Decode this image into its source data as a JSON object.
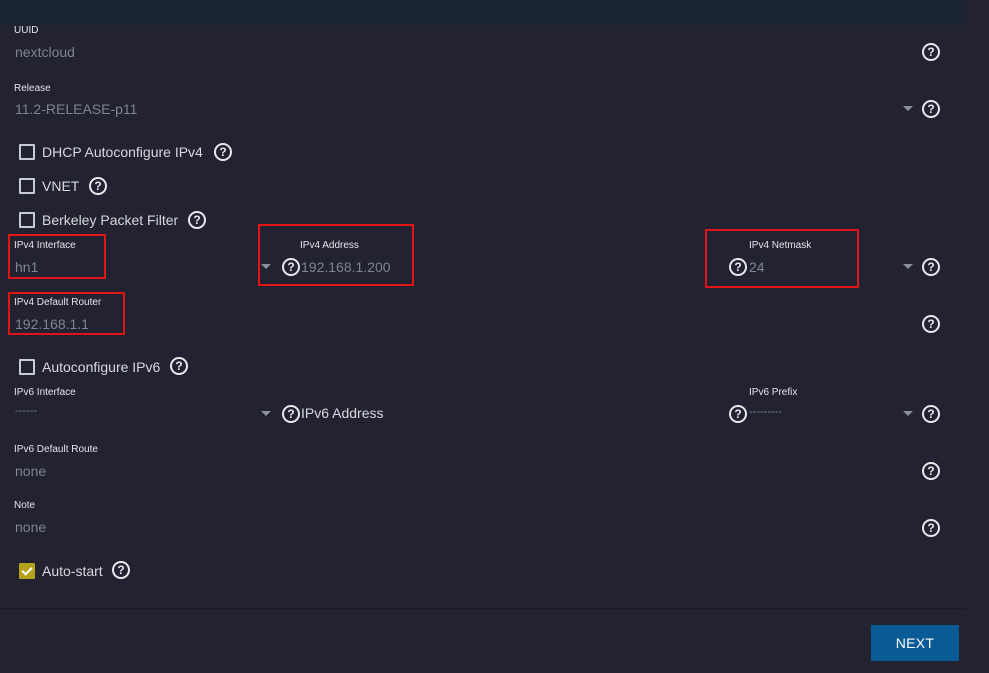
{
  "fields": {
    "uuid": {
      "label": "UUID",
      "value": "nextcloud"
    },
    "release": {
      "label": "Release",
      "value": "11.2-RELEASE-p11"
    },
    "ipv4_interface": {
      "label": "IPv4 Interface",
      "value": "hn1"
    },
    "ipv4_address": {
      "label": "IPv4 Address",
      "value": "192.168.1.200"
    },
    "ipv4_netmask": {
      "label": "IPv4 Netmask",
      "value": "24"
    },
    "ipv4_default_router": {
      "label": "IPv4 Default Router",
      "value": "192.168.1.1"
    },
    "ipv6_interface": {
      "label": "IPv6 Interface",
      "value": "------"
    },
    "ipv6_address": {
      "label": "IPv6 Address"
    },
    "ipv6_prefix": {
      "label": "IPv6 Prefix",
      "value": "---------"
    },
    "ipv6_default_route": {
      "label": "IPv6 Default Route",
      "value": "none"
    },
    "note": {
      "label": "Note",
      "value": "none"
    }
  },
  "checkboxes": {
    "dhcp": {
      "label": "DHCP Autoconfigure IPv4",
      "checked": false
    },
    "vnet": {
      "label": "VNET",
      "checked": false
    },
    "bpf": {
      "label": "Berkeley Packet Filter",
      "checked": false
    },
    "autoconf_ipv6": {
      "label": "Autoconfigure IPv6",
      "checked": false
    },
    "autostart": {
      "label": "Auto-start",
      "checked": true
    }
  },
  "help_glyph": "?",
  "buttons": {
    "next": "NEXT"
  },
  "colors": {
    "highlight": "#e01515",
    "primary_button": "#0a5a96",
    "checked_box": "#b5a21c"
  }
}
